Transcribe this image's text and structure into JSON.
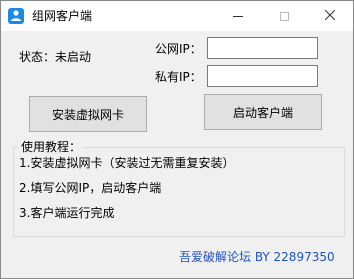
{
  "window": {
    "title": "组网客户端"
  },
  "status": {
    "text": "状态：未启动"
  },
  "public_ip": {
    "label": "公网IP：",
    "value": ""
  },
  "private_ip": {
    "label": "私有IP：",
    "value": ""
  },
  "buttons": {
    "install_label": "安装虚拟网卡",
    "start_label": "启动客户端"
  },
  "tutorial": {
    "title": "使用教程：",
    "steps": [
      "1.安装虚拟网卡（安装过无需重复安装）",
      "2.填写公网IP，启动客户端",
      "3.客户端运行完成"
    ]
  },
  "footer": {
    "text": "吾爱破解论坛 BY 22897350"
  },
  "icons": {
    "app": "people-network-icon",
    "minimize": "minimize-icon",
    "maximize": "maximize-icon",
    "close": "close-icon"
  },
  "colors": {
    "footer_link": "#1f52c8",
    "app_icon": "#1e88e5"
  }
}
